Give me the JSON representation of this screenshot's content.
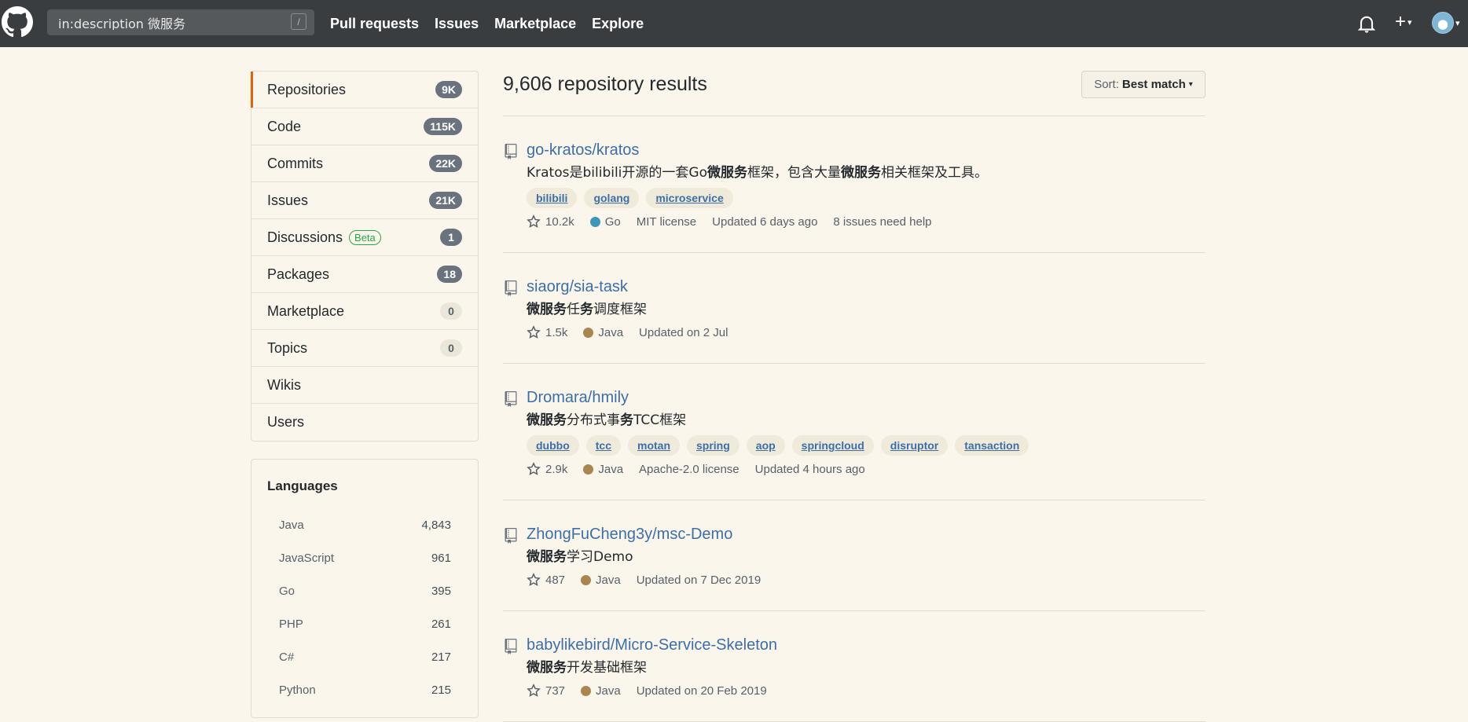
{
  "header": {
    "search_value": "in:description 微服务",
    "search_shortcut": "/",
    "nav": [
      "Pull requests",
      "Issues",
      "Marketplace",
      "Explore"
    ],
    "plus_label": "+",
    "caret": "▾"
  },
  "sidebar": {
    "items": [
      {
        "label": "Repositories",
        "count": "9K"
      },
      {
        "label": "Code",
        "count": "115K"
      },
      {
        "label": "Commits",
        "count": "22K"
      },
      {
        "label": "Issues",
        "count": "21K"
      },
      {
        "label": "Discussions",
        "badge": "Beta",
        "count": "1"
      },
      {
        "label": "Packages",
        "count": "18"
      },
      {
        "label": "Marketplace",
        "count": "0"
      },
      {
        "label": "Topics",
        "count": "0"
      },
      {
        "label": "Wikis",
        "count": ""
      },
      {
        "label": "Users",
        "count": ""
      }
    ]
  },
  "languages": {
    "title": "Languages",
    "items": [
      {
        "name": "Java",
        "count": "4,843"
      },
      {
        "name": "JavaScript",
        "count": "961"
      },
      {
        "name": "Go",
        "count": "395"
      },
      {
        "name": "PHP",
        "count": "261"
      },
      {
        "name": "C#",
        "count": "217"
      },
      {
        "name": "Python",
        "count": "215"
      }
    ]
  },
  "results": {
    "title": "9,606 repository results",
    "sort_label": "Sort:",
    "sort_value": "Best match"
  },
  "repos": [
    {
      "name": "go-kratos/kratos",
      "desc": [
        [
          "Kratos是bilibili开源的一套Go",
          false
        ],
        [
          "微服务",
          true
        ],
        [
          "框架，包含大量",
          false
        ],
        [
          "微服务",
          true
        ],
        [
          "相关框架及工具。",
          false
        ]
      ],
      "topics": [
        "bilibili",
        "golang",
        "microservice"
      ],
      "stars": "10.2k",
      "language": "Go",
      "lang_color": "#3d97b8",
      "license": "MIT license",
      "updated": "Updated 6 days ago",
      "issues": "8 issues need help"
    },
    {
      "name": "siaorg/sia-task",
      "desc": [
        [
          "微服务",
          true
        ],
        [
          "任",
          false
        ],
        [
          "务",
          true
        ],
        [
          "调度框架",
          false
        ]
      ],
      "topics": [],
      "stars": "1.5k",
      "language": "Java",
      "lang_color": "#a98550",
      "license": "",
      "updated": "Updated on 2 Jul",
      "issues": ""
    },
    {
      "name": "Dromara/hmily",
      "desc": [
        [
          "微服务",
          true
        ],
        [
          "分布式事",
          false
        ],
        [
          "务",
          true
        ],
        [
          "TCC框架",
          false
        ]
      ],
      "topics": [
        "dubbo",
        "tcc",
        "motan",
        "spring",
        "aop",
        "springcloud",
        "disruptor",
        "tansaction"
      ],
      "stars": "2.9k",
      "language": "Java",
      "lang_color": "#a98550",
      "license": "Apache-2.0 license",
      "updated": "Updated 4 hours ago",
      "issues": ""
    },
    {
      "name": "ZhongFuCheng3y/msc-Demo",
      "desc": [
        [
          "微服务",
          true
        ],
        [
          "学习Demo",
          false
        ]
      ],
      "topics": [],
      "stars": "487",
      "language": "Java",
      "lang_color": "#a98550",
      "license": "",
      "updated": "Updated on 7 Dec 2019",
      "issues": ""
    },
    {
      "name": "babylikebird/Micro-Service-Skeleton",
      "desc": [
        [
          "微服务",
          true
        ],
        [
          "开发基础框架",
          false
        ]
      ],
      "topics": [],
      "stars": "737",
      "language": "Java",
      "lang_color": "#a98550",
      "license": "",
      "updated": "Updated on 20 Feb 2019",
      "issues": ""
    }
  ]
}
